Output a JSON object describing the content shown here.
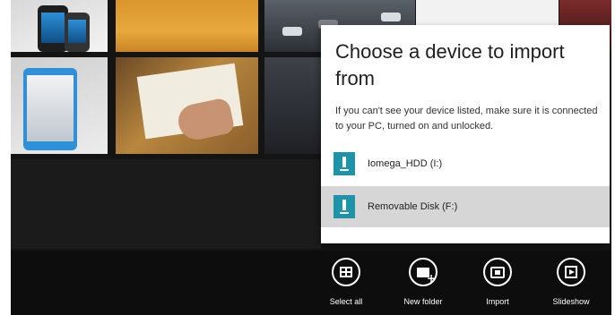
{
  "dialog": {
    "title": "Choose a device to import from",
    "description": "If you can't see your device listed, make sure it is connected to your PC, turned on and unlocked.",
    "devices": [
      {
        "label": "Iomega_HDD (I:)",
        "icon": "usb-drive-icon",
        "selected": false
      },
      {
        "label": "Removable Disk (F:)",
        "icon": "usb-drive-icon",
        "selected": true
      }
    ]
  },
  "appbar": {
    "commands": [
      {
        "label": "Select all",
        "icon": "select-all-icon"
      },
      {
        "label": "New folder",
        "icon": "new-folder-icon"
      },
      {
        "label": "Import",
        "icon": "import-icon"
      },
      {
        "label": "Slideshow",
        "icon": "slideshow-icon"
      }
    ]
  },
  "colors": {
    "dialog_background": "#ffffff",
    "selected_item": "#d6d6d6",
    "device_icon": "#1f93a8",
    "app_bar": "#0d0d0d"
  }
}
